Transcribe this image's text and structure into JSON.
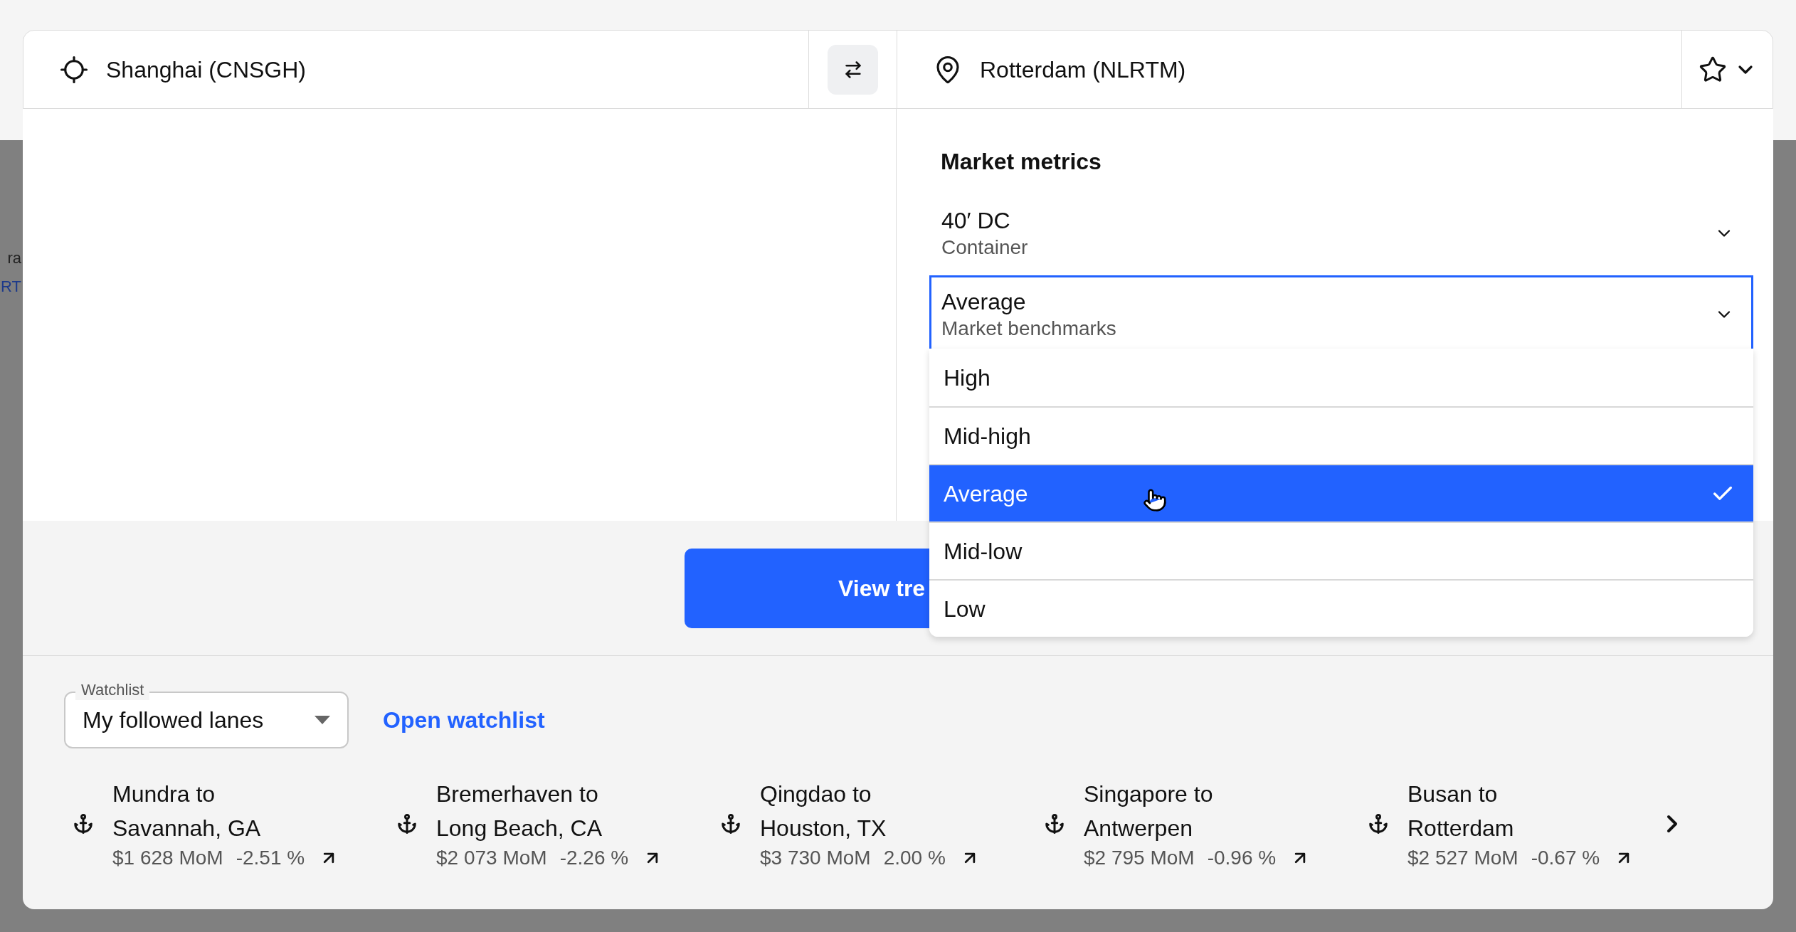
{
  "background_fragments": [
    "ra",
    "RT"
  ],
  "route": {
    "origin": "Shanghai (CNSGH)",
    "destination": "Rotterdam (NLRTM)"
  },
  "market_metrics": {
    "title": "Market metrics",
    "selects": [
      {
        "value": "40′ DC",
        "label": "Container",
        "focused": false
      },
      {
        "value": "Average",
        "label": "Market benchmarks",
        "focused": true
      }
    ],
    "options": [
      {
        "label": "High",
        "selected": false
      },
      {
        "label": "Mid-high",
        "selected": false
      },
      {
        "label": "Average",
        "selected": true
      },
      {
        "label": "Mid-low",
        "selected": false
      },
      {
        "label": "Low",
        "selected": false
      }
    ]
  },
  "view_button": "View tre",
  "watchlist": {
    "label": "Watchlist",
    "value": "My followed lanes",
    "link": "Open watchlist",
    "lanes": [
      {
        "title": "Mundra to\nSavannah, GA",
        "price": "$1 628 MoM",
        "change": "-2.51 %"
      },
      {
        "title": "Bremerhaven to\nLong Beach, CA",
        "price": "$2 073 MoM",
        "change": "-2.26 %"
      },
      {
        "title": "Qingdao to\nHouston, TX",
        "price": "$3 730 MoM",
        "change": "2.00 %"
      },
      {
        "title": "Singapore to\nAntwerpen",
        "price": "$2 795 MoM",
        "change": "-0.96 %"
      },
      {
        "title": "Busan to\nRotterdam",
        "price": "$2 527 MoM",
        "change": "-0.67 %"
      }
    ]
  }
}
